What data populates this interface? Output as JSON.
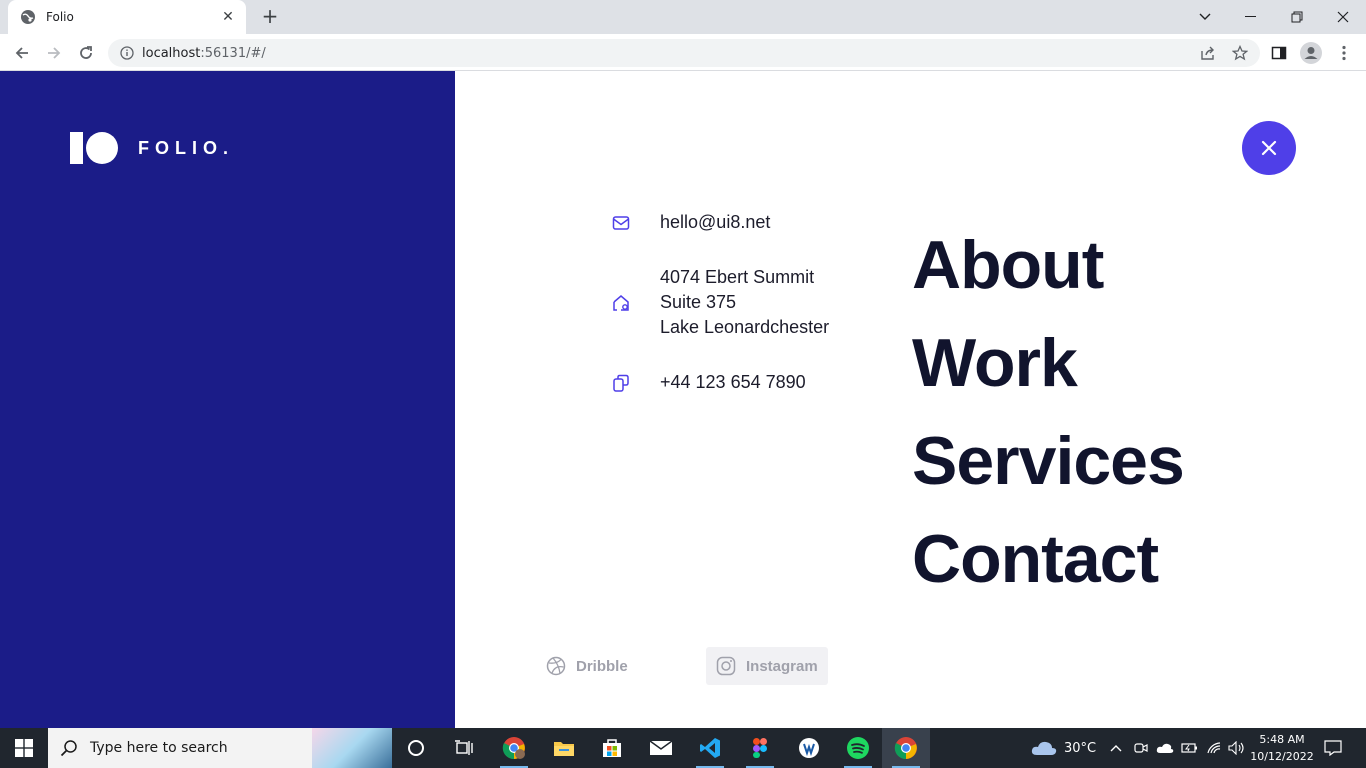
{
  "browser": {
    "tab_title": "Folio",
    "url_host": "localhost",
    "url_rest": ":56131/#/"
  },
  "site": {
    "logo_text": "FOLIO.",
    "contact": {
      "email": "hello@ui8.net",
      "address_line1": "4074 Ebert Summit",
      "address_line2": "Suite 375",
      "address_line3": "Lake Leonardchester",
      "phone": "+44 123 654 7890"
    },
    "menu": [
      "About",
      "Work",
      "Services",
      "Contact"
    ],
    "social": {
      "dribble": "Dribble",
      "instagram": "Instagram"
    },
    "colors": {
      "sidebar": "#1b1c88",
      "accent": "#4f3fe8",
      "menu_text": "#11142d"
    }
  },
  "taskbar": {
    "search_placeholder": "Type here to search",
    "weather": "30°C",
    "time": "5:48 AM",
    "date": "10/12/2022"
  }
}
